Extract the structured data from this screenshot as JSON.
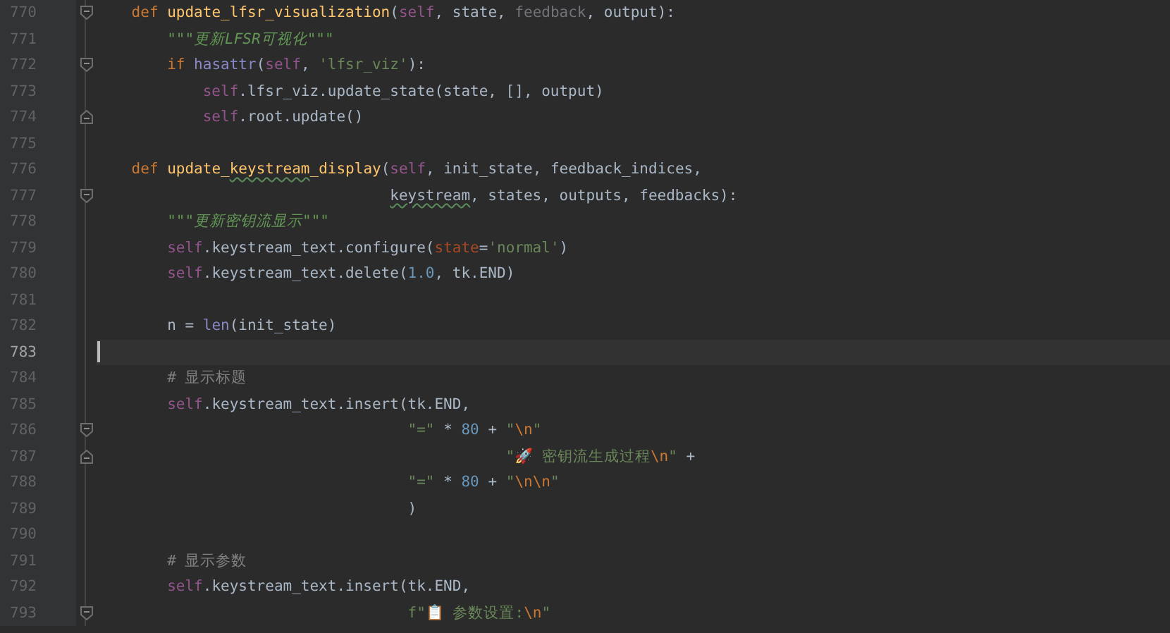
{
  "lines": [
    {
      "n": "770",
      "fold": {
        "kind": "start"
      },
      "current": false,
      "tokens": [
        {
          "kind": "kw",
          "text": "    def "
        },
        {
          "kind": "fn",
          "text": "update_lfsr_visualization"
        },
        {
          "kind": "plain",
          "text": "("
        },
        {
          "kind": "self",
          "text": "self"
        },
        {
          "kind": "plain",
          "text": ", state, "
        },
        {
          "kind": "unused",
          "text": "feedback"
        },
        {
          "kind": "plain",
          "text": ", output):"
        }
      ]
    },
    {
      "n": "771",
      "current": false,
      "tokens": [
        {
          "kind": "doc",
          "text": "        \"\"\"更新LFSR可视化\"\"\""
        }
      ]
    },
    {
      "n": "772",
      "fold": {
        "kind": "start"
      },
      "current": false,
      "tokens": [
        {
          "kind": "kw",
          "text": "        if "
        },
        {
          "kind": "builtin",
          "text": "hasattr"
        },
        {
          "kind": "plain",
          "text": "("
        },
        {
          "kind": "self",
          "text": "self"
        },
        {
          "kind": "plain",
          "text": ", "
        },
        {
          "kind": "str",
          "text": "'lfsr_viz'"
        },
        {
          "kind": "plain",
          "text": "):"
        }
      ]
    },
    {
      "n": "773",
      "current": false,
      "tokens": [
        {
          "kind": "self",
          "text": "            self"
        },
        {
          "kind": "plain",
          "text": ".lfsr_viz.update_state(state, [], output)"
        }
      ]
    },
    {
      "n": "774",
      "fold": {
        "kind": "end"
      },
      "current": false,
      "tokens": [
        {
          "kind": "self",
          "text": "            self"
        },
        {
          "kind": "plain",
          "text": ".root.update()"
        }
      ]
    },
    {
      "n": "775",
      "current": false
    },
    {
      "n": "776",
      "current": false,
      "tokens": [
        {
          "kind": "kw",
          "text": "    def "
        },
        {
          "kind": "fn",
          "text": "update_"
        },
        {
          "kind": "fntypo",
          "text": "keystream"
        },
        {
          "kind": "fn",
          "text": "_display"
        },
        {
          "kind": "plain",
          "text": "("
        },
        {
          "kind": "self",
          "text": "self"
        },
        {
          "kind": "plain",
          "text": ", init_state, feedback_indices,"
        }
      ]
    },
    {
      "n": "777",
      "fold": {
        "kind": "start"
      },
      "current": false,
      "tokens": [
        {
          "kind": "typo",
          "text": "                                 keystream"
        },
        {
          "kind": "plain",
          "text": ", states, outputs, feedbacks):"
        }
      ]
    },
    {
      "n": "778",
      "current": false,
      "tokens": [
        {
          "kind": "doc",
          "text": "        \"\"\"更新密钥流显示\"\"\""
        }
      ]
    },
    {
      "n": "779",
      "current": false,
      "tokens": [
        {
          "kind": "self",
          "text": "        self"
        },
        {
          "kind": "plain",
          "text": ".keystream_text.configure("
        },
        {
          "kind": "namedarg",
          "text": "state"
        },
        {
          "kind": "plain",
          "text": "="
        },
        {
          "kind": "str",
          "text": "'normal'"
        },
        {
          "kind": "plain",
          "text": ")"
        }
      ]
    },
    {
      "n": "780",
      "current": false,
      "tokens": [
        {
          "kind": "self",
          "text": "        self"
        },
        {
          "kind": "plain",
          "text": ".keystream_text.delete("
        },
        {
          "kind": "num",
          "text": "1.0"
        },
        {
          "kind": "plain",
          "text": ", tk.END)"
        }
      ]
    },
    {
      "n": "781",
      "current": false
    },
    {
      "n": "782",
      "current": false,
      "tokens": [
        {
          "kind": "plain",
          "text": "        n = "
        },
        {
          "kind": "builtin",
          "text": "len"
        },
        {
          "kind": "plain",
          "text": "(init_state)"
        }
      ]
    },
    {
      "n": "783",
      "current": true
    },
    {
      "n": "784",
      "current": false,
      "tokens": [
        {
          "kind": "cmt",
          "text": "        # 显示标题"
        }
      ]
    },
    {
      "n": "785",
      "current": false,
      "tokens": [
        {
          "kind": "self",
          "text": "        self"
        },
        {
          "kind": "plain",
          "text": ".keystream_text.insert(tk.END,"
        }
      ]
    },
    {
      "n": "786",
      "fold": {
        "kind": "start"
      },
      "current": false,
      "tokens": [
        {
          "kind": "str",
          "text": "                                   \"=\""
        },
        {
          "kind": "plain",
          "text": " * "
        },
        {
          "kind": "num",
          "text": "80"
        },
        {
          "kind": "plain",
          "text": " + "
        },
        {
          "kind": "str",
          "text": "\""
        },
        {
          "kind": "esc",
          "text": "\\n"
        },
        {
          "kind": "str",
          "text": "\""
        }
      ]
    },
    {
      "n": "787",
      "fold": {
        "kind": "end"
      },
      "current": false,
      "tokens": [
        {
          "kind": "str",
          "text": "                                              \"🚀 密钥流生成过程"
        },
        {
          "kind": "esc",
          "text": "\\n"
        },
        {
          "kind": "str",
          "text": "\""
        },
        {
          "kind": "plain",
          "text": " +"
        }
      ]
    },
    {
      "n": "788",
      "current": false,
      "tokens": [
        {
          "kind": "str",
          "text": "                                   \"=\""
        },
        {
          "kind": "plain",
          "text": " * "
        },
        {
          "kind": "num",
          "text": "80"
        },
        {
          "kind": "plain",
          "text": " + "
        },
        {
          "kind": "str",
          "text": "\""
        },
        {
          "kind": "esc",
          "text": "\\n\\n"
        },
        {
          "kind": "str",
          "text": "\""
        }
      ]
    },
    {
      "n": "789",
      "current": false,
      "tokens": [
        {
          "kind": "plain",
          "text": "                                   )"
        }
      ]
    },
    {
      "n": "790",
      "current": false
    },
    {
      "n": "791",
      "current": false,
      "tokens": [
        {
          "kind": "cmt",
          "text": "        # 显示参数"
        }
      ]
    },
    {
      "n": "792",
      "current": false,
      "tokens": [
        {
          "kind": "self",
          "text": "        self"
        },
        {
          "kind": "plain",
          "text": ".keystream_text.insert(tk.END,"
        }
      ]
    },
    {
      "n": "793",
      "fold": {
        "kind": "start"
      },
      "current": false,
      "tokens": [
        {
          "kind": "str",
          "text": "                                   f\"📋 参数设置:"
        },
        {
          "kind": "esc",
          "text": "\\n"
        },
        {
          "kind": "str",
          "text": "\""
        }
      ]
    }
  ]
}
